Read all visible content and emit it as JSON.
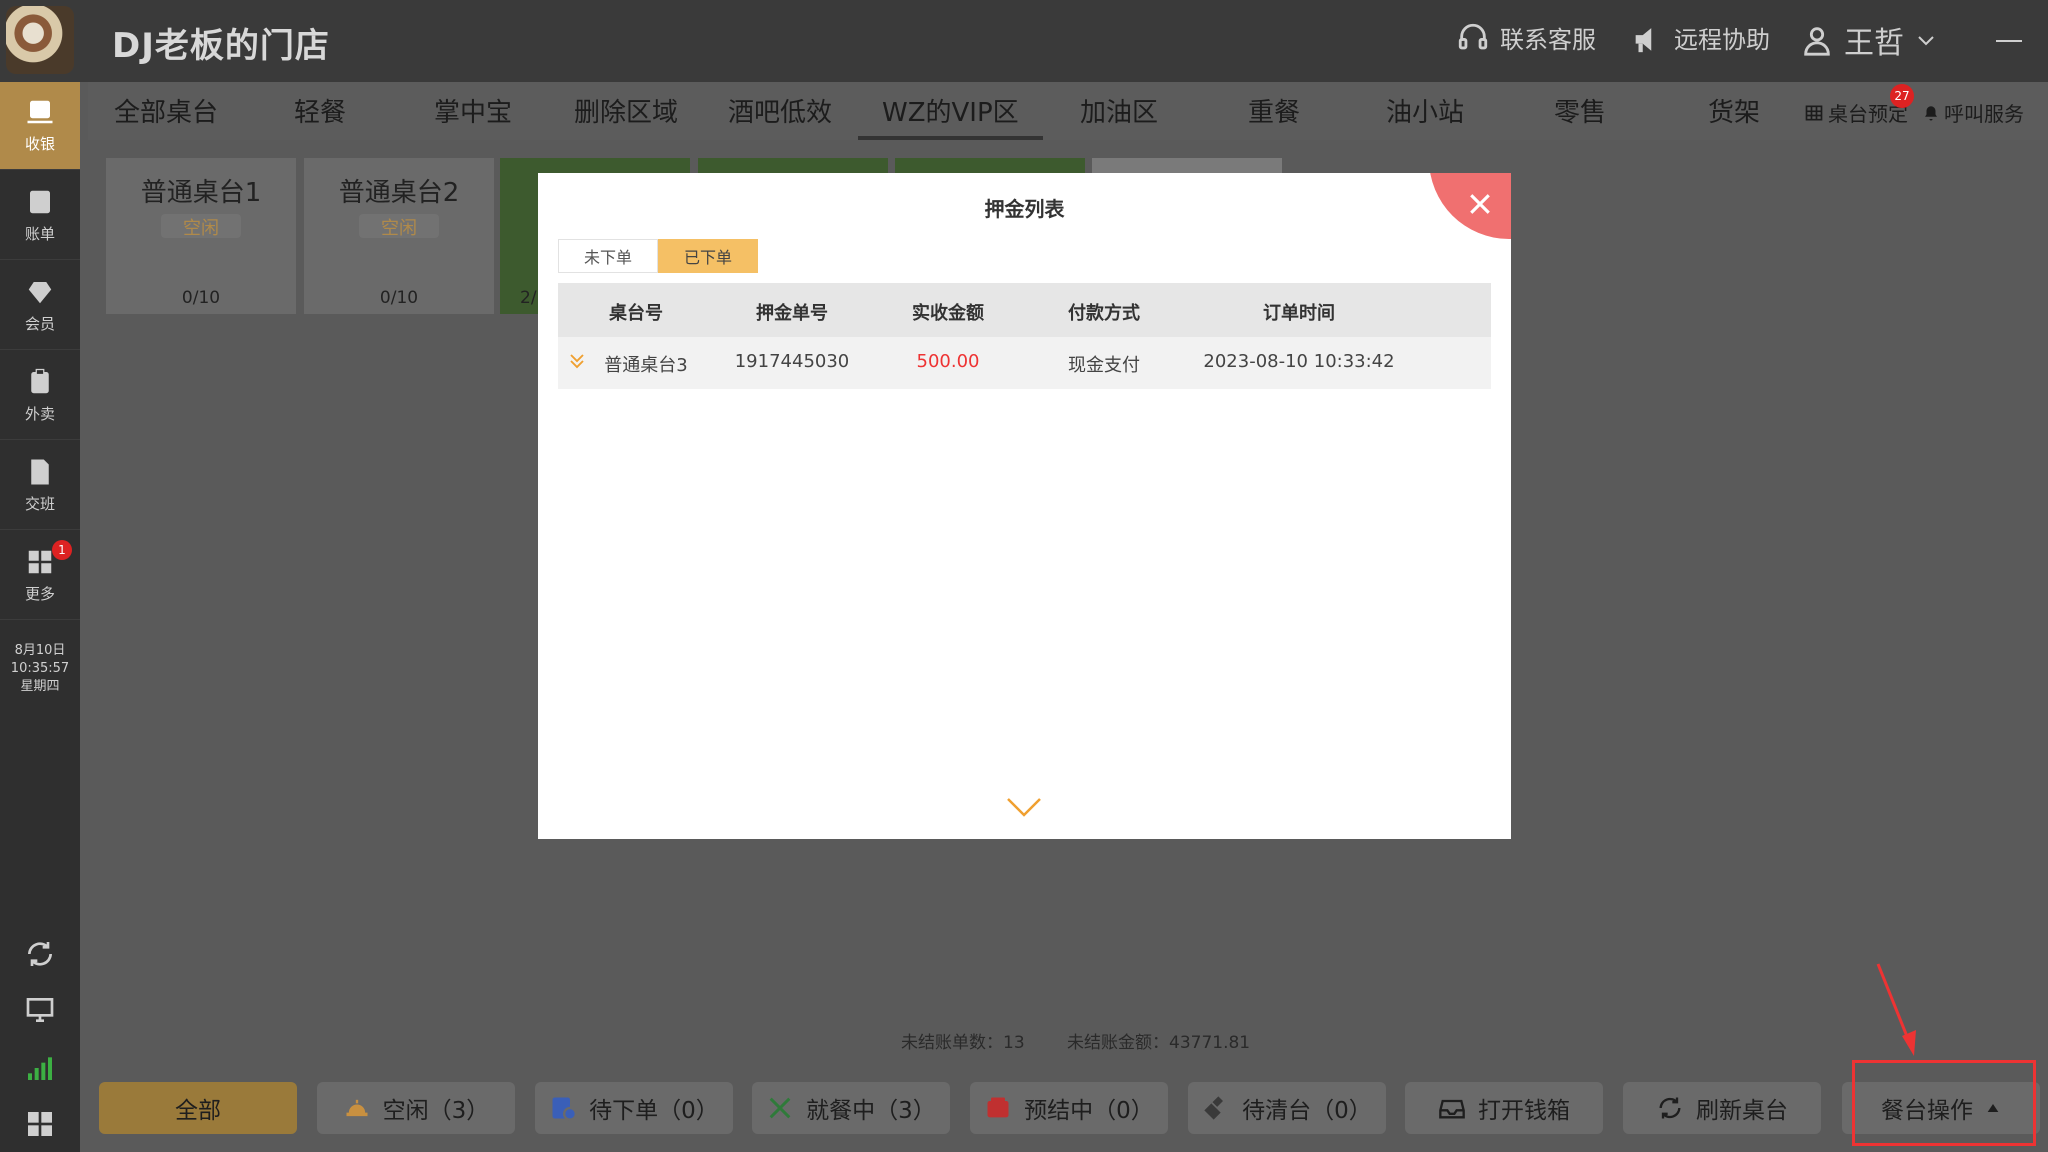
{
  "header": {
    "store_name": "DJ老板的门店",
    "support": "联系客服",
    "remote": "远程协助",
    "user": "王哲"
  },
  "sidebar": {
    "items": [
      {
        "label": "收银",
        "icon": "cashier-icon",
        "active": true
      },
      {
        "label": "账单",
        "icon": "bill-icon"
      },
      {
        "label": "会员",
        "icon": "member-icon"
      },
      {
        "label": "外卖",
        "icon": "takeout-icon"
      },
      {
        "label": "交班",
        "icon": "shift-icon"
      },
      {
        "label": "更多",
        "icon": "more-grid-icon",
        "badge": "1"
      }
    ],
    "date": "8月10日",
    "time": "10:35:57",
    "weekday": "星期四"
  },
  "area_tabs": {
    "items": [
      "全部桌台",
      "轻餐",
      "掌中宝",
      "删除区域",
      "酒吧低效",
      "WZ的VIP区",
      "加油区",
      "重餐",
      "油小站",
      "零售",
      "货架"
    ],
    "active": "WZ的VIP区",
    "reserve": "桌台预定",
    "reserve_badge": "27",
    "call": "呼叫服务"
  },
  "tables": [
    {
      "name": "普通桌台1",
      "status": "空闲",
      "capacity": "0/10"
    },
    {
      "name": "普通桌台2",
      "status": "空闲",
      "capacity": "0/10"
    },
    {
      "name": "",
      "status": "",
      "capacity": "2/"
    }
  ],
  "summary": {
    "unsettled_count_label": "未结账单数：",
    "unsettled_count": "13",
    "unsettled_amount_label": "未结账金额：",
    "unsettled_amount": "43771.81"
  },
  "bottom_buttons": {
    "all": "全部",
    "idle": "空闲（3）",
    "pending": "待下单（0）",
    "dining": "就餐中（3）",
    "presettle": "预结中（0）",
    "toclean": "待清台（0）",
    "drawer": "打开钱箱",
    "refresh": "刷新桌台",
    "ops": "餐台操作"
  },
  "modal": {
    "title": "押金列表",
    "tabs": [
      "未下单",
      "已下单"
    ],
    "active_tab": "已下单",
    "columns": [
      "桌台号",
      "押金单号",
      "实收金额",
      "付款方式",
      "订单时间"
    ],
    "rows": [
      {
        "table": "普通桌台3",
        "deposit_no": "1917445030",
        "amount": "500.00",
        "payment": "现金支付",
        "time": "2023-08-10 10:33:42"
      }
    ]
  },
  "colors": {
    "accent": "#b08a4a",
    "tab_active": "#f5c065",
    "money": "#ee3333",
    "close": "#f07070"
  }
}
